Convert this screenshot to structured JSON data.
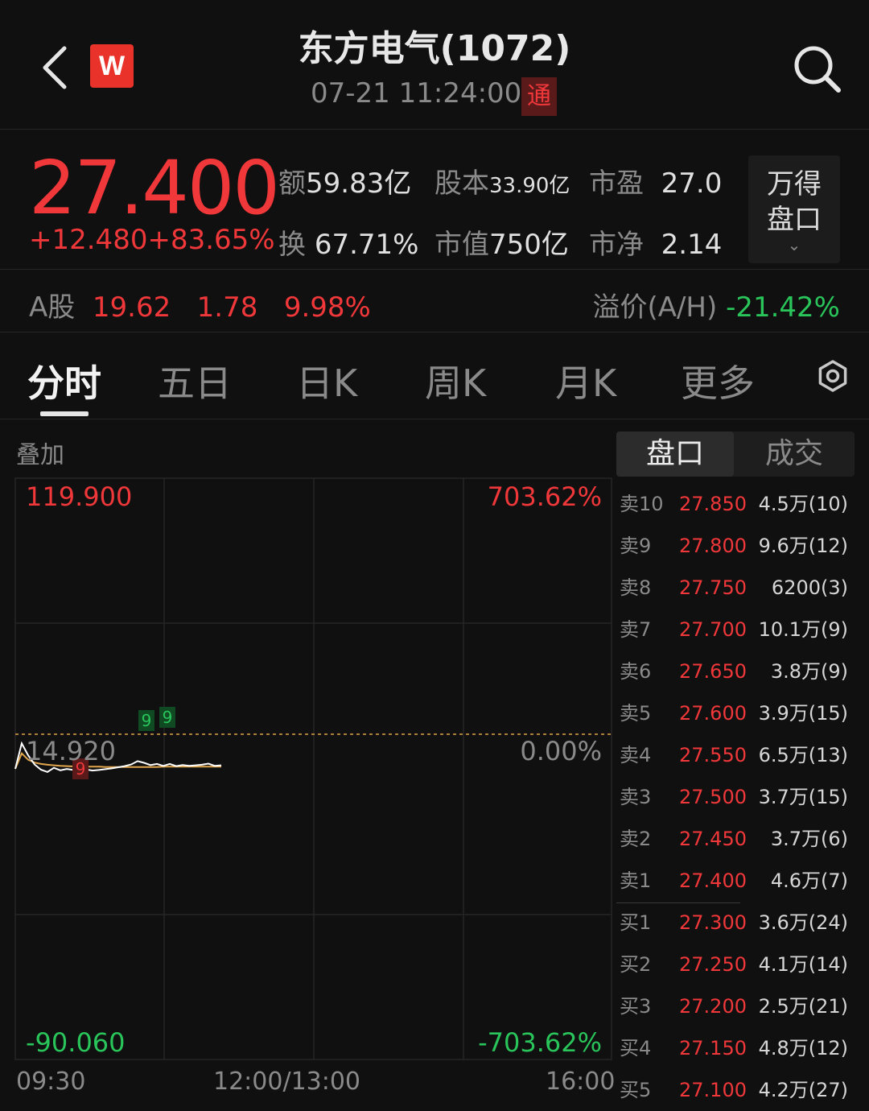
{
  "header": {
    "title": "东方电气(1072)",
    "timestamp": "07-21 11:24:00",
    "connect_badge": "通",
    "logo_text": "W"
  },
  "quote": {
    "price": "27.400",
    "change": "+12.480",
    "change_pct": "+83.65%",
    "stats": [
      {
        "key": "额",
        "value": "59.83亿"
      },
      {
        "key": "股本",
        "value": "33.90亿"
      },
      {
        "key": "市盈",
        "value": "27.0"
      },
      {
        "key": "换",
        "value": "67.71%"
      },
      {
        "key": "市值",
        "value": "750亿"
      },
      {
        "key": "市净",
        "value": "2.14"
      }
    ],
    "wind_pankou_button": [
      "万得",
      "盘口"
    ]
  },
  "ashare": {
    "label": "A股",
    "price": "19.62",
    "change": "1.78",
    "change_pct": "9.98%",
    "premium_label": "溢价(A/H)",
    "premium_value": "-21.42%"
  },
  "tabs": [
    "分时",
    "五日",
    "日K",
    "周K",
    "月K",
    "更多"
  ],
  "active_tab": 0,
  "chart": {
    "overlay_label": "叠加",
    "y_top_price": "119.900",
    "y_top_pct": "703.62%",
    "y_mid_price": "14.920",
    "y_mid_pct": "0.00%",
    "y_bottom_price": "-90.060",
    "y_bottom_pct": "-703.62%",
    "x_labels": [
      "09:30",
      "12:00/13:00",
      "16:00"
    ],
    "markers": [
      {
        "text": "9",
        "color": "green"
      },
      {
        "text": "9",
        "color": "green"
      },
      {
        "text": "9",
        "color": "red"
      }
    ]
  },
  "chart_data": {
    "type": "line",
    "title": "",
    "xlabel": "",
    "ylabel": "",
    "ylim": [
      -90.06,
      119.9
    ],
    "x_ticks": [
      "09:30",
      "12:00/13:00",
      "16:00"
    ],
    "reference_price": 14.92,
    "series": [
      {
        "name": "",
        "color": "#ffffff",
        "values": [
          14.92,
          24.1,
          19.8,
          16.5,
          14.6,
          13.8,
          15.3,
          14.4,
          14.9,
          14.5,
          14.6,
          14.7,
          14.3,
          14.5,
          14.8,
          15.1,
          15.5,
          15.9,
          16.5,
          17.7,
          17.1,
          16.3,
          16.7,
          16.0,
          16.7,
          15.9,
          16.3,
          16.0,
          16.2,
          16.4,
          16.8,
          16.0,
          16.2
        ]
      },
      {
        "name": "",
        "color": "#e0a64b",
        "values": [
          14.92,
          20.5,
          18.2,
          17.2,
          16.7,
          16.4,
          16.2,
          16.0,
          15.9,
          15.8,
          15.8,
          15.7,
          15.7,
          15.7,
          15.6,
          15.6,
          15.6,
          15.6,
          15.6,
          15.6,
          15.6,
          15.6,
          15.6,
          15.7,
          15.7,
          15.7,
          15.7,
          15.7,
          15.7,
          15.7,
          15.7,
          15.7,
          15.7
        ]
      }
    ]
  },
  "orderbook": {
    "tabs": [
      "盘口",
      "成交"
    ],
    "rows": [
      {
        "level": "卖10",
        "price": "27.850",
        "vol": "4.5万(10)"
      },
      {
        "level": "卖9",
        "price": "27.800",
        "vol": "9.6万(12)"
      },
      {
        "level": "卖8",
        "price": "27.750",
        "vol": "6200(3)"
      },
      {
        "level": "卖7",
        "price": "27.700",
        "vol": "10.1万(9)"
      },
      {
        "level": "卖6",
        "price": "27.650",
        "vol": "3.8万(9)"
      },
      {
        "level": "卖5",
        "price": "27.600",
        "vol": "3.9万(15)"
      },
      {
        "level": "卖4",
        "price": "27.550",
        "vol": "6.5万(13)"
      },
      {
        "level": "卖3",
        "price": "27.500",
        "vol": "3.7万(15)"
      },
      {
        "level": "卖2",
        "price": "27.450",
        "vol": "3.7万(6)"
      },
      {
        "level": "卖1",
        "price": "27.400",
        "vol": "4.6万(7)"
      },
      {
        "level": "买1",
        "price": "27.300",
        "vol": "3.6万(24)"
      },
      {
        "level": "买2",
        "price": "27.250",
        "vol": "4.1万(14)"
      },
      {
        "level": "买3",
        "price": "27.200",
        "vol": "2.5万(21)"
      },
      {
        "level": "买4",
        "price": "27.150",
        "vol": "4.8万(12)"
      },
      {
        "level": "买5",
        "price": "27.100",
        "vol": "4.2万(27)"
      }
    ]
  },
  "colors": {
    "up": "#f0373a",
    "down": "#29c45a",
    "price_line": "#ffffff",
    "avg_line": "#e0a64b",
    "background": "#101010"
  },
  "icons": {
    "back": "chevron-left-icon",
    "search": "search-icon",
    "settings": "settings-icon"
  }
}
